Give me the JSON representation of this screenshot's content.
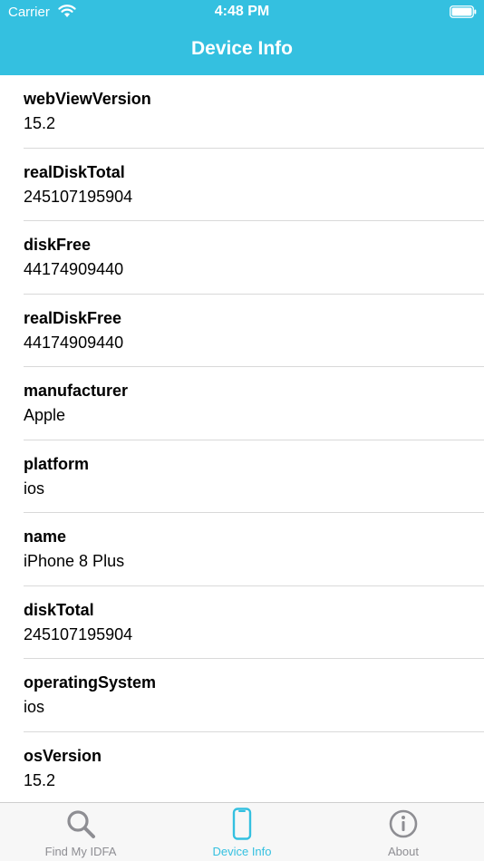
{
  "status_bar": {
    "carrier": "Carrier",
    "time": "4:48 PM"
  },
  "nav": {
    "title": "Device Info"
  },
  "colors": {
    "header": "#34c0e0",
    "accent": "#34c0e0",
    "inactive": "#8e8e93"
  },
  "items": [
    {
      "label": "webViewVersion",
      "value": "15.2"
    },
    {
      "label": "realDiskTotal",
      "value": "245107195904"
    },
    {
      "label": "diskFree",
      "value": "44174909440"
    },
    {
      "label": "realDiskFree",
      "value": "44174909440"
    },
    {
      "label": "manufacturer",
      "value": "Apple"
    },
    {
      "label": "platform",
      "value": "ios"
    },
    {
      "label": "name",
      "value": "iPhone 8 Plus"
    },
    {
      "label": "diskTotal",
      "value": "245107195904"
    },
    {
      "label": "operatingSystem",
      "value": "ios"
    },
    {
      "label": "osVersion",
      "value": "15.2"
    }
  ],
  "tabs": [
    {
      "label": "Find My IDFA",
      "icon": "search-icon",
      "active": false
    },
    {
      "label": "Device Info",
      "icon": "phone-icon",
      "active": true
    },
    {
      "label": "About",
      "icon": "info-icon",
      "active": false
    }
  ]
}
